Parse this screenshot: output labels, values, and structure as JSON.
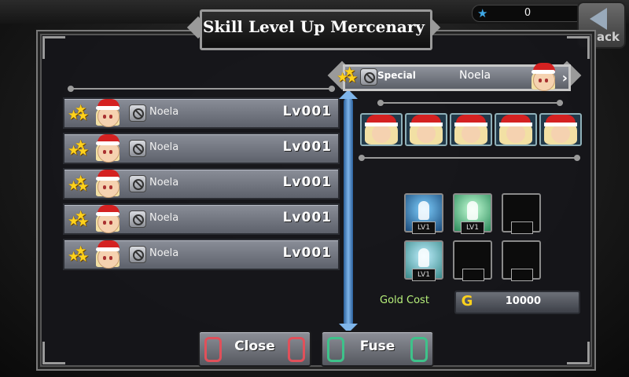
{
  "title": "Skill Level Up Mercenary",
  "top_stat_value": "0",
  "back_label": "Back",
  "list": [
    {
      "name": "Noela",
      "level": "Lv001",
      "stars": 3
    },
    {
      "name": "Noela",
      "level": "Lv001",
      "stars": 3
    },
    {
      "name": "Noela",
      "level": "Lv001",
      "stars": 3
    },
    {
      "name": "Noela",
      "level": "Lv001",
      "stars": 3
    },
    {
      "name": "Noela",
      "level": "Lv001",
      "stars": 3
    }
  ],
  "selected": {
    "class": "Special",
    "name": "Noela",
    "stars": 3
  },
  "fodder_count": 5,
  "skills": [
    {
      "icon": "skill-a",
      "level": "LV1"
    },
    {
      "icon": "skill-b",
      "level": "LV1"
    },
    {
      "icon": "empty",
      "level": ""
    },
    {
      "icon": "skill-c",
      "level": "LV1"
    },
    {
      "icon": "empty",
      "level": ""
    },
    {
      "icon": "empty",
      "level": ""
    }
  ],
  "gold": {
    "label": "Gold Cost",
    "value": "10000"
  },
  "buttons": {
    "close": "Close",
    "fuse": "Fuse"
  },
  "colors": {
    "accent_blue": "#7fb5ea",
    "gold_label": "#b7f07a",
    "close_knot": "#e0505a",
    "fuse_knot": "#3ec28a",
    "star": "#ffd21c"
  }
}
